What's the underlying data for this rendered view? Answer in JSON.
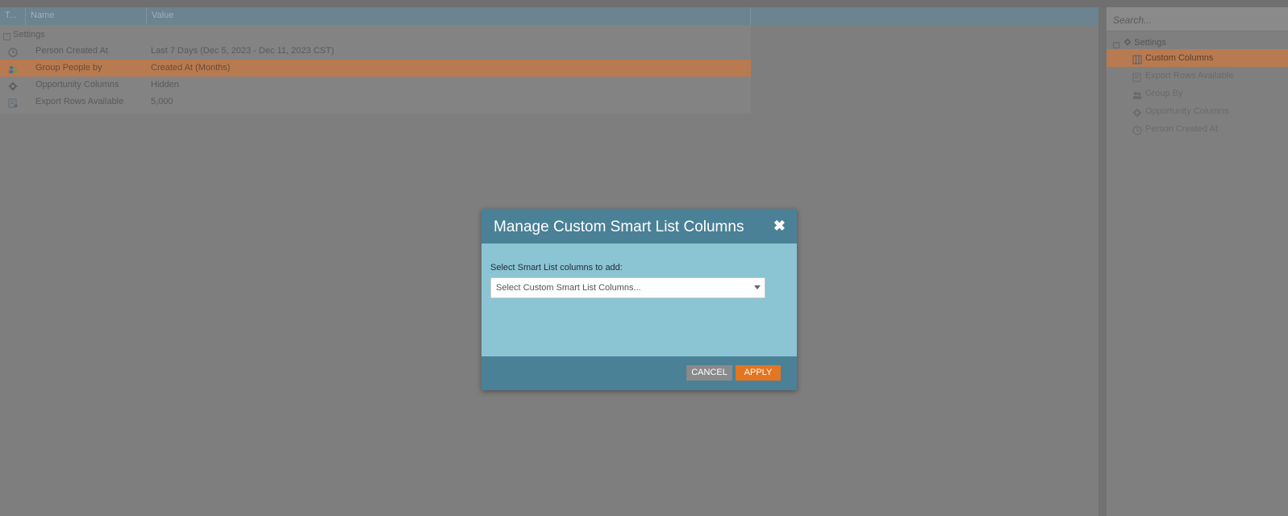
{
  "grid": {
    "columns": [
      "T...",
      "Name",
      "Value"
    ],
    "group": "Settings",
    "rows": [
      {
        "icon": "clock-icon",
        "name": "Person Created At",
        "value": "Last 7 Days (Dec 5, 2023 - Dec 11, 2023 CST)",
        "selected": false
      },
      {
        "icon": "group-people-icon",
        "name": "Group People by",
        "value": "Created At (Months)",
        "selected": true
      },
      {
        "icon": "gear-icon",
        "name": "Opportunity Columns",
        "value": "Hidden",
        "selected": false
      },
      {
        "icon": "export-icon",
        "name": "Export Rows Available",
        "value": "5,000",
        "selected": false
      }
    ]
  },
  "right_panel": {
    "search_placeholder": "Search...",
    "tree_root": "Settings",
    "items": [
      {
        "icon": "custom-columns-icon",
        "label": "Custom Columns",
        "selected": true
      },
      {
        "icon": "export-icon",
        "label": "Export Rows Available",
        "selected": false
      },
      {
        "icon": "group-people-icon",
        "label": "Group By",
        "selected": false
      },
      {
        "icon": "gear-icon",
        "label": "Opportunity Columns",
        "selected": false
      },
      {
        "icon": "clock-icon",
        "label": "Person Created At",
        "selected": false
      }
    ]
  },
  "modal": {
    "title": "Manage Custom Smart List Columns",
    "close_symbol": "✖",
    "field_label": "Select Smart List columns to add:",
    "select_placeholder": "Select Custom Smart List Columns...",
    "cancel_label": "CANCEL",
    "apply_label": "APPLY"
  },
  "colors": {
    "selection": "#b87a50",
    "modal_header": "#4a8196",
    "modal_body": "#8bc4d3",
    "apply_button": "#e47521"
  }
}
